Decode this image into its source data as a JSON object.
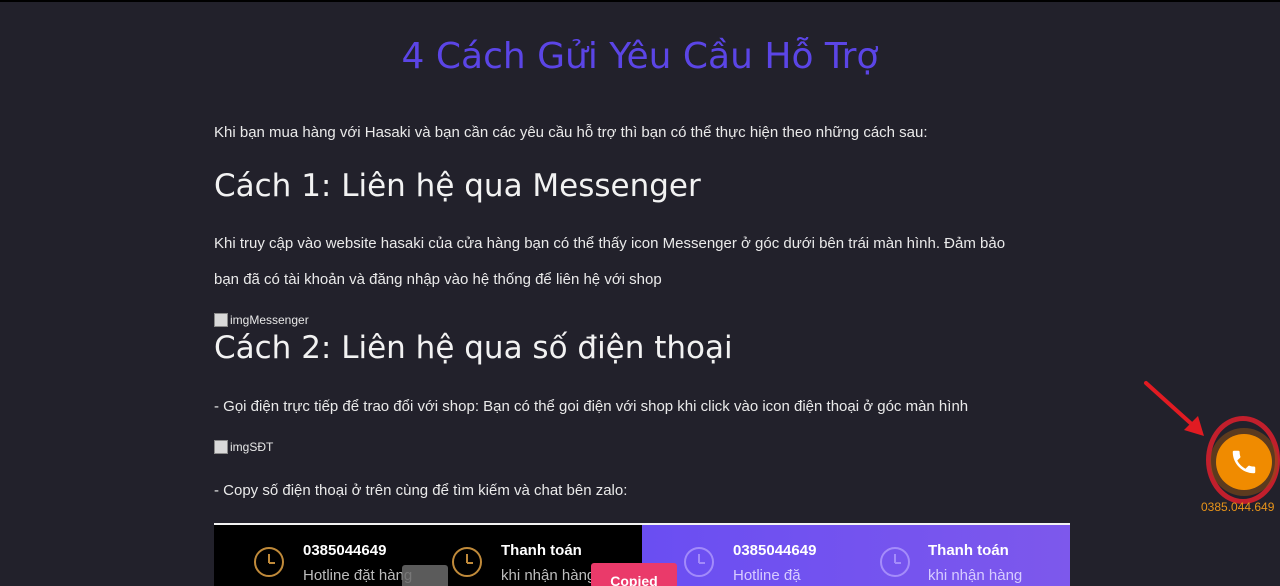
{
  "page": {
    "title": "4 Cách Gửi Yêu Cầu Hỗ Trợ",
    "intro": "Khi bạn mua hàng với Hasaki và bạn cần các yêu cầu hỗ trợ thì bạn có thể thực hiện theo những cách sau:"
  },
  "method1": {
    "heading": "Cách 1: Liên hệ qua Messenger",
    "text_line1": "Khi truy cập vào website hasaki của cửa hàng bạn có thể thấy icon Messenger ở góc dưới bên trái màn hình. Đảm bảo",
    "text_line2": "bạn đã có tài khoản và đăng nhập vào hệ thống để liên hệ với shop",
    "img_alt": "imgMessenger"
  },
  "method2": {
    "heading": "Cách 2: Liên hệ qua số điện thoại",
    "text1": "- Gọi điện trực tiếp để trao đổi với shop: Bạn có thể goi điện với shop khi click vào icon điện thoại ở góc màn hình",
    "img_alt": "imgSĐT",
    "text2": "- Copy số điện thoại ở trên cùng để tìm kiếm và chat bên zalo:"
  },
  "banner": {
    "left": {
      "hotline_number": "0385044649",
      "hotline_label": "Hotline đặt hàng",
      "payment_title": "Thanh toán",
      "payment_label": "khi nhận hàng"
    },
    "right": {
      "hotline_number": "0385044649",
      "hotline_label": "Hotline đặ",
      "payment_title": "Thanh toán",
      "payment_label": "khi nhận hàng",
      "toast": "Copied"
    },
    "colors": {
      "dark": "#000000",
      "purple": "#6a4ef2",
      "clock": "#c08a3a"
    }
  },
  "call_widget": {
    "icon": "phone-icon",
    "number": "0385.044.649",
    "color": "#f08b00",
    "highlight_color": "#c21f2c"
  },
  "colors": {
    "background": "#22212b",
    "title": "#5b45e6"
  }
}
